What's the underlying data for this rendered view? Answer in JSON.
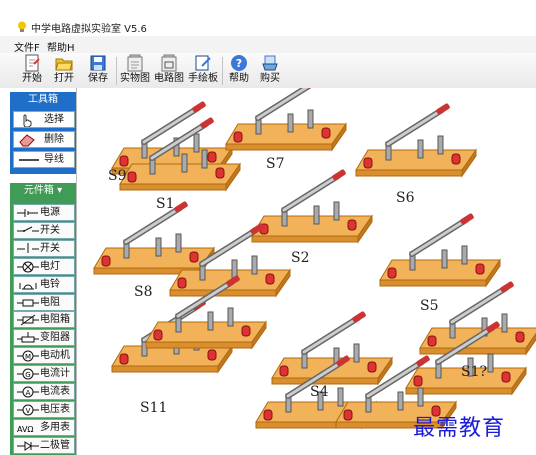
{
  "window": {
    "title": "中学电路虚拟实验室 V5.6"
  },
  "menu": [
    {
      "label": "文件F"
    },
    {
      "label": "帮助H"
    }
  ],
  "toolbar": [
    {
      "label": "开始",
      "icon": "new-file-icon"
    },
    {
      "label": "打开",
      "icon": "open-folder-icon"
    },
    {
      "label": "保存",
      "icon": "save-disk-icon"
    },
    {
      "label": "实物图",
      "icon": "real-view-icon"
    },
    {
      "label": "电路图",
      "icon": "circuit-diagram-icon"
    },
    {
      "label": "手绘板",
      "icon": "drawing-board-icon"
    },
    {
      "label": "帮助",
      "icon": "help-icon"
    },
    {
      "label": "购买",
      "icon": "purchase-icon"
    }
  ],
  "toolbox": {
    "header": "工具箱",
    "items": [
      {
        "label": "选择",
        "icon": "hand-pointer-icon"
      },
      {
        "label": "删除",
        "icon": "eraser-icon"
      },
      {
        "label": "导线",
        "icon": "wire-line-icon"
      }
    ]
  },
  "components": {
    "header": "元件箱",
    "items": [
      {
        "label": "电源",
        "icon": "battery-symbol-icon"
      },
      {
        "label": "开关",
        "icon": "switch-symbol-icon"
      },
      {
        "label": "开关",
        "icon": "switch-vertical-symbol-icon"
      },
      {
        "label": "电灯",
        "icon": "lamp-symbol-icon"
      },
      {
        "label": "电铃",
        "icon": "bell-symbol-icon"
      },
      {
        "label": "电阻",
        "icon": "resistor-symbol-icon"
      },
      {
        "label": "电阻箱",
        "icon": "resistance-box-symbol-icon"
      },
      {
        "label": "变阻器",
        "icon": "rheostat-symbol-icon"
      },
      {
        "label": "电动机",
        "icon": "motor-symbol-icon"
      },
      {
        "label": "电流计",
        "icon": "galvanometer-symbol-icon"
      },
      {
        "label": "电流表",
        "icon": "ammeter-symbol-icon"
      },
      {
        "label": "电压表",
        "icon": "voltmeter-symbol-icon"
      },
      {
        "label": "多用表",
        "icon": "multimeter-symbol-icon"
      },
      {
        "label": "二极管",
        "icon": "diode-symbol-icon"
      }
    ]
  },
  "canvas": {
    "switches": [
      {
        "id": "S1"
      },
      {
        "id": "S2"
      },
      {
        "id": "S4"
      },
      {
        "id": "S5"
      },
      {
        "id": "S6"
      },
      {
        "id": "S7"
      },
      {
        "id": "S8"
      },
      {
        "id": "S9"
      },
      {
        "id": "S11"
      },
      {
        "id": "S1?"
      }
    ]
  },
  "watermark": "最需教育"
}
